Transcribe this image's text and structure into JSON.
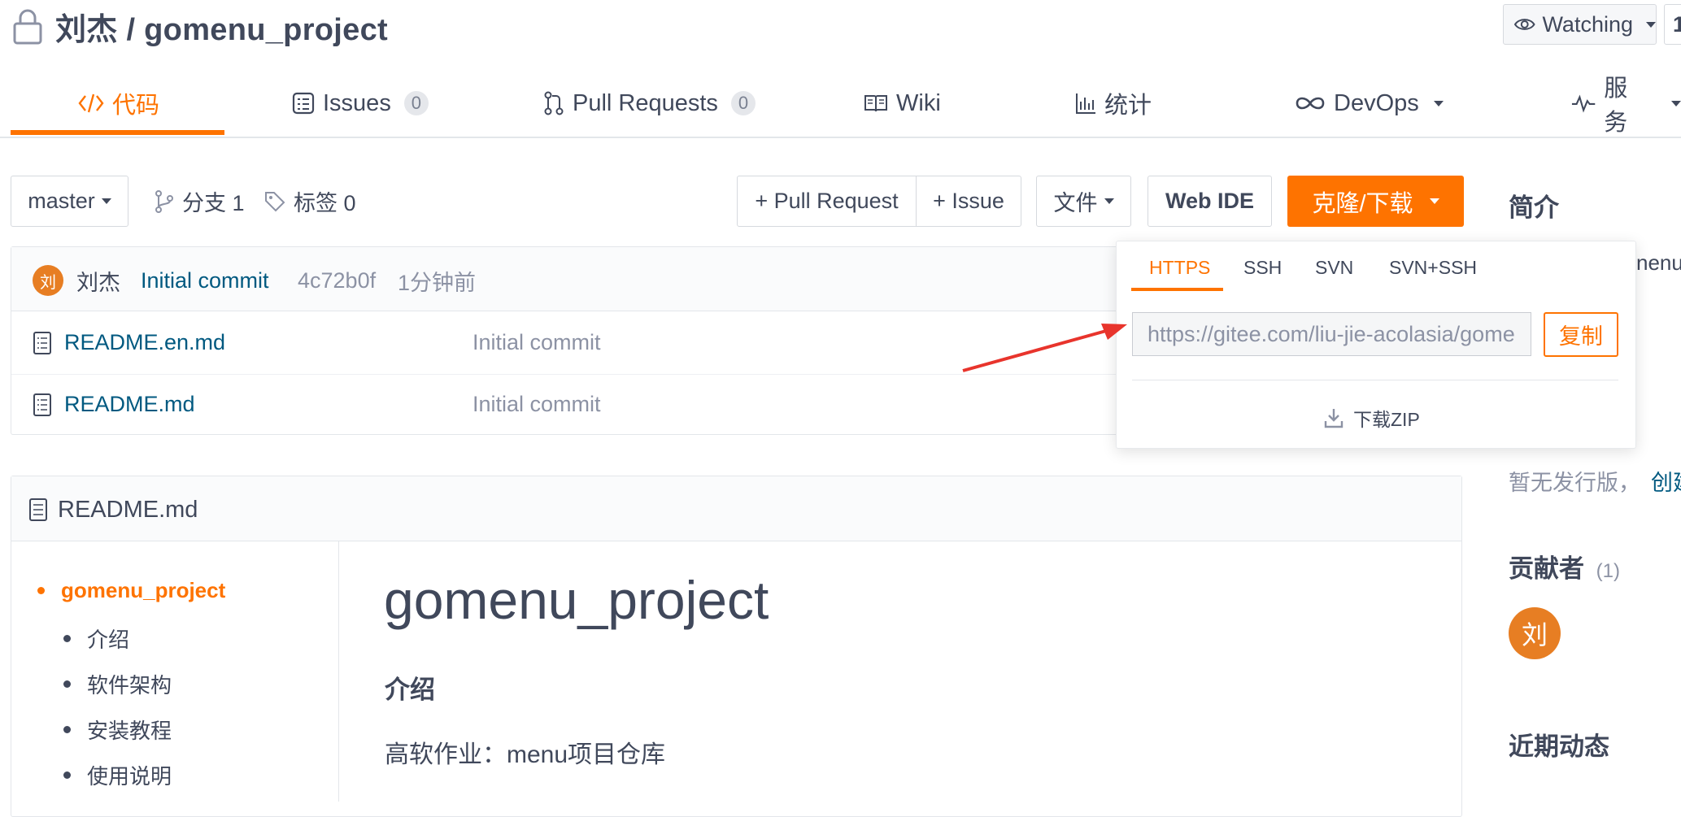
{
  "header": {
    "repo_title": "刘杰 / gomenu_project",
    "watch_label": "Watching",
    "watch_count": "1"
  },
  "tabs": [
    {
      "label": "代码",
      "icon": "code-icon"
    },
    {
      "label": "Issues",
      "count": "0",
      "icon": "issues-icon"
    },
    {
      "label": "Pull Requests",
      "count": "0",
      "icon": "pull-request-icon"
    },
    {
      "label": "Wiki",
      "icon": "book-icon"
    },
    {
      "label": "统计",
      "icon": "bar-chart-icon"
    },
    {
      "label": "DevOps",
      "icon": "infinity-icon"
    },
    {
      "label": "服务",
      "icon": "pulse-icon"
    }
  ],
  "toolbar": {
    "branch": "master",
    "branches": "分支 1",
    "tags": "标签 0",
    "pull_request": "+ Pull Request",
    "issue": "+ Issue",
    "file": "文件",
    "web_ide": "Web IDE",
    "clone": "克隆/下载"
  },
  "commit": {
    "avatar": "刘",
    "author": "刘杰",
    "message": "Initial commit",
    "hash": "4c72b0f",
    "time": "1分钟前"
  },
  "files": [
    {
      "name": "README.en.md",
      "message": "Initial commit"
    },
    {
      "name": "README.md",
      "message": "Initial commit"
    }
  ],
  "readme": {
    "filename": "README.md",
    "toc": [
      "gomenu_project",
      "介绍",
      "软件架构",
      "安装教程",
      "使用说明"
    ],
    "title": "gomenu_project",
    "section": "介绍",
    "text": "高软作业：menu项目仓库"
  },
  "sidebar": {
    "intro": "简介",
    "intro_cut": "nenu",
    "release_text": "暂无发行版，",
    "release_link": "创建",
    "contributors": "贡献者",
    "contributors_count": "(1)",
    "contributor_avatar": "刘",
    "recent": "近期动态"
  },
  "clone_panel": {
    "tabs": [
      "HTTPS",
      "SSH",
      "SVN",
      "SVN+SSH"
    ],
    "active_tab": "HTTPS",
    "url": "https://gitee.com/liu-jie-acolasia/gomenu_project.git",
    "copy": "复制",
    "download": "下载ZIP"
  },
  "colors": {
    "accent": "#fe7300",
    "link": "#005980",
    "text": "#40485b"
  }
}
